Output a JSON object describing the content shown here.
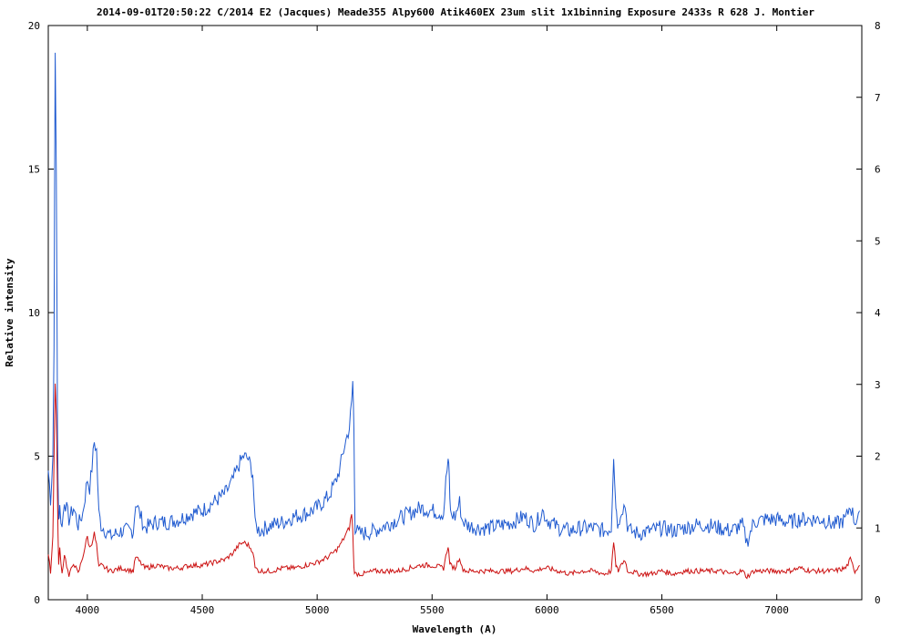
{
  "chart_data": {
    "type": "line",
    "title": "2014-09-01T20:50:22 C/2014 E2 (Jacques) Meade355 Alpy600 Atik460EX 23um slit 1x1binning Exposure 2433s R 628 J. Montier",
    "xlabel": "Wavelength (A)",
    "ylabel": "Relative intensity",
    "xlim": [
      3830,
      7370
    ],
    "ylim": [
      0,
      20
    ],
    "y2lim": [
      0,
      8
    ],
    "x_ticks": [
      "4000",
      "4500",
      "5000",
      "5500",
      "6000",
      "6500",
      "7000"
    ],
    "y_ticks": [
      "0",
      "5",
      "10",
      "15",
      "20"
    ],
    "y2_ticks": [
      "0",
      "1",
      "2",
      "3",
      "4",
      "5",
      "6",
      "7",
      "8"
    ],
    "grid": false,
    "series": [
      {
        "axis": "left",
        "color": "#1f5ad0",
        "x": [
          3830,
          3840,
          3850,
          3855,
          3860,
          3865,
          3870,
          3875,
          3880,
          3890,
          3900,
          3920,
          3940,
          3960,
          3980,
          4000,
          4010,
          4020,
          4030,
          4040,
          4050,
          4060,
          4080,
          4100,
          4150,
          4200,
          4210,
          4250,
          4300,
          4350,
          4400,
          4450,
          4500,
          4550,
          4600,
          4630,
          4660,
          4680,
          4700,
          4720,
          4730,
          4750,
          4800,
          4850,
          4900,
          4950,
          5000,
          5050,
          5080,
          5100,
          5120,
          5140,
          5150,
          5155,
          5160,
          5165,
          5180,
          5200,
          5250,
          5300,
          5350,
          5400,
          5450,
          5500,
          5550,
          5560,
          5570,
          5575,
          5580,
          5600,
          5620,
          5630,
          5650,
          5700,
          5750,
          5800,
          5850,
          5900,
          5950,
          5980,
          6000,
          6050,
          6100,
          6150,
          6200,
          6250,
          6280,
          6290,
          6300,
          6305,
          6310,
          6320,
          6340,
          6350,
          6360,
          6400,
          6450,
          6500,
          6550,
          6600,
          6650,
          6700,
          6750,
          6800,
          6850,
          6870,
          6900,
          6950,
          7000,
          7050,
          7100,
          7150,
          7200,
          7250,
          7300,
          7320,
          7340,
          7360
        ],
        "y": [
          4.5,
          3.5,
          5,
          9,
          19,
          15,
          6,
          2.8,
          3.2,
          2.5,
          3.5,
          2.8,
          3.2,
          2.6,
          3,
          4.2,
          3.9,
          4.6,
          5.5,
          5.2,
          3,
          2.6,
          2.4,
          2.2,
          2.4,
          2.4,
          3.4,
          2.5,
          2.7,
          2.7,
          2.8,
          3,
          3.1,
          3.4,
          3.7,
          4.1,
          4.7,
          5,
          4.9,
          4.4,
          2.6,
          2.4,
          2.6,
          2.7,
          2.9,
          3,
          3.2,
          3.6,
          4.1,
          4.6,
          5.4,
          6,
          6.8,
          7.6,
          6,
          2.5,
          2.3,
          2.3,
          2.4,
          2.6,
          2.8,
          3,
          3.2,
          3.1,
          3,
          4.1,
          4.9,
          4.2,
          3,
          2.9,
          3.4,
          2.8,
          2.6,
          2.5,
          2.5,
          2.6,
          2.7,
          2.9,
          2.6,
          3.1,
          2.8,
          2.5,
          2.4,
          2.5,
          2.5,
          2.4,
          2.5,
          5.1,
          3.3,
          2.9,
          2.5,
          3.1,
          3.3,
          2.6,
          2.4,
          2.3,
          2.4,
          2.5,
          2.4,
          2.5,
          2.6,
          2.6,
          2.5,
          2.4,
          2.6,
          2,
          2.7,
          2.8,
          2.8,
          2.7,
          2.8,
          2.8,
          2.8,
          2.6,
          2.8,
          3.3,
          2.7,
          3.1
        ]
      },
      {
        "axis": "left",
        "color": "#cc1111",
        "x": [
          3830,
          3840,
          3850,
          3855,
          3860,
          3865,
          3870,
          3875,
          3880,
          3890,
          3900,
          3920,
          3940,
          3960,
          3980,
          4000,
          4010,
          4020,
          4030,
          4040,
          4050,
          4060,
          4080,
          4100,
          4150,
          4200,
          4210,
          4250,
          4300,
          4350,
          4400,
          4450,
          4500,
          4550,
          4600,
          4630,
          4660,
          4680,
          4700,
          4720,
          4730,
          4750,
          4800,
          4850,
          4900,
          4950,
          5000,
          5050,
          5080,
          5100,
          5120,
          5140,
          5150,
          5155,
          5160,
          5165,
          5180,
          5200,
          5250,
          5300,
          5350,
          5400,
          5450,
          5500,
          5550,
          5560,
          5570,
          5575,
          5580,
          5600,
          5620,
          5630,
          5650,
          5700,
          5750,
          5800,
          5850,
          5900,
          5950,
          5980,
          6000,
          6050,
          6100,
          6150,
          6200,
          6250,
          6280,
          6290,
          6300,
          6305,
          6310,
          6320,
          6340,
          6350,
          6360,
          6400,
          6450,
          6500,
          6550,
          6600,
          6650,
          6700,
          6750,
          6800,
          6850,
          6870,
          6900,
          6950,
          7000,
          7050,
          7100,
          7150,
          7200,
          7250,
          7300,
          7320,
          7340,
          7360
        ],
        "y": [
          1.5,
          1,
          2.2,
          5,
          7.5,
          6.5,
          3.5,
          1.2,
          1.8,
          0.9,
          1.6,
          0.8,
          1.3,
          0.9,
          1.5,
          2.2,
          1.8,
          2,
          2.3,
          1.9,
          1.1,
          1.2,
          1.1,
          1,
          1.1,
          1,
          1.5,
          1.1,
          1.2,
          1.1,
          1.1,
          1.2,
          1.2,
          1.3,
          1.4,
          1.6,
          1.9,
          2,
          1.9,
          1.7,
          1.1,
          1,
          1,
          1.1,
          1.1,
          1.2,
          1.3,
          1.5,
          1.7,
          1.9,
          2.2,
          2.5,
          3,
          2.4,
          1.1,
          0.9,
          0.9,
          0.9,
          1,
          1,
          1,
          1.1,
          1.2,
          1.2,
          1.1,
          1.5,
          1.9,
          1.4,
          1.2,
          1.1,
          1.5,
          1.1,
          1,
          1,
          1,
          1,
          1,
          1.1,
          1,
          1.1,
          1.1,
          1,
          0.9,
          1,
          1,
          0.9,
          1,
          2,
          1.2,
          1.1,
          1,
          1.2,
          1.4,
          1,
          1,
          0.9,
          0.9,
          1,
          0.9,
          1,
          1,
          1,
          1,
          0.9,
          1,
          0.8,
          1,
          1,
          1,
          1,
          1.1,
          1,
          1,
          1,
          1.1,
          1.4,
          1,
          1.2
        ]
      }
    ]
  }
}
